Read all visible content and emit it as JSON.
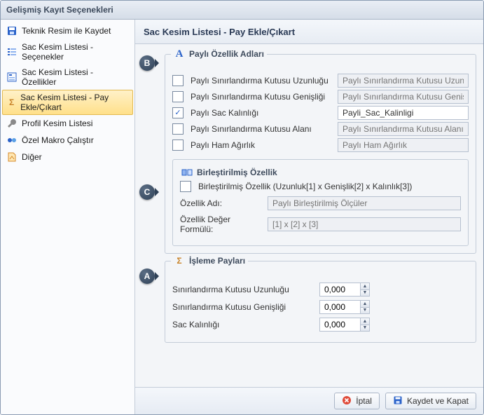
{
  "window": {
    "title": "Gelişmiş Kayıt Seçenekleri"
  },
  "sidebar": {
    "items": [
      {
        "label": "Teknik Resim ile Kaydet",
        "icon": "save-icon",
        "color": "#2a62c9"
      },
      {
        "label": "Sac Kesim Listesi - Seçenekler",
        "icon": "list-icon",
        "color": "#2a62c9"
      },
      {
        "label": "Sac Kesim Listesi - Özellikler",
        "icon": "list-props-icon",
        "color": "#2a62c9"
      },
      {
        "label": "Sac Kesim Listesi - Pay Ekle/Çıkart",
        "icon": "sigma-icon",
        "color": "#c9842a",
        "selected": true
      },
      {
        "label": "Profil Kesim Listesi",
        "icon": "wrench-icon",
        "color": "#6a6a6a"
      },
      {
        "label": "Özel Makro Çalıştır",
        "icon": "macro-icon",
        "color": "#2a62c9"
      },
      {
        "label": "Diğer",
        "icon": "other-icon",
        "color": "#d58a2a"
      }
    ]
  },
  "main": {
    "header": "Sac Kesim Listesi - Pay Ekle/Çıkart",
    "groupA": {
      "title": "Paylı Özellik Adları",
      "rows": [
        {
          "label": "Paylı Sınırlandırma Kutusu Uzunluğu",
          "checked": false,
          "value": "",
          "placeholder": "Paylı Sınırlandırma Kutusu Uzunluğu",
          "enabled": false
        },
        {
          "label": "Paylı Sınırlandırma Kutusu Genişliği",
          "checked": false,
          "value": "",
          "placeholder": "Paylı Sınırlandırma Kutusu Genişliği",
          "enabled": false
        },
        {
          "label": "Paylı Sac Kalınlığı",
          "checked": true,
          "value": "Payli_Sac_Kalinligi",
          "placeholder": "",
          "enabled": true
        },
        {
          "label": "Paylı Sınırlandırma Kutusu Alanı",
          "checked": false,
          "value": "",
          "placeholder": "Paylı Sınırlandırma Kutusu Alanı",
          "enabled": false
        },
        {
          "label": "Paylı Ham Ağırlık",
          "checked": false,
          "value": "",
          "placeholder": "Paylı Ham Ağırlık",
          "enabled": false
        }
      ],
      "merged": {
        "group_title": "Birleştirilmiş Özellik",
        "checkbox_label": "Birleştirilmiş Özellik (Uzunluk[1] x Genişlik[2] x Kalınlık[3])",
        "checked": false,
        "name_label": "Özellik Adı:",
        "name_placeholder": "Paylı Birleştirilmiş Ölçüler",
        "formula_label": "Özellik Değer Formülü:",
        "formula_placeholder": "[1] x [2] x [3]"
      }
    },
    "groupB": {
      "title": "İşleme Payları",
      "rows": [
        {
          "label": "Sınırlandırma Kutusu Uzunluğu",
          "value": "0,000"
        },
        {
          "label": "Sınırlandırma Kutusu Genişliği",
          "value": "0,000"
        },
        {
          "label": "Sac Kalınlığı",
          "value": "0,000"
        }
      ]
    }
  },
  "callouts": {
    "a": "A",
    "b": "B",
    "c": "C"
  },
  "footer": {
    "cancel": "İptal",
    "save": "Kaydet ve Kapat"
  },
  "glyphs": {
    "check": "✓",
    "sigma": "Σ",
    "letter_a": "A",
    "up": "▲",
    "down": "▼"
  }
}
